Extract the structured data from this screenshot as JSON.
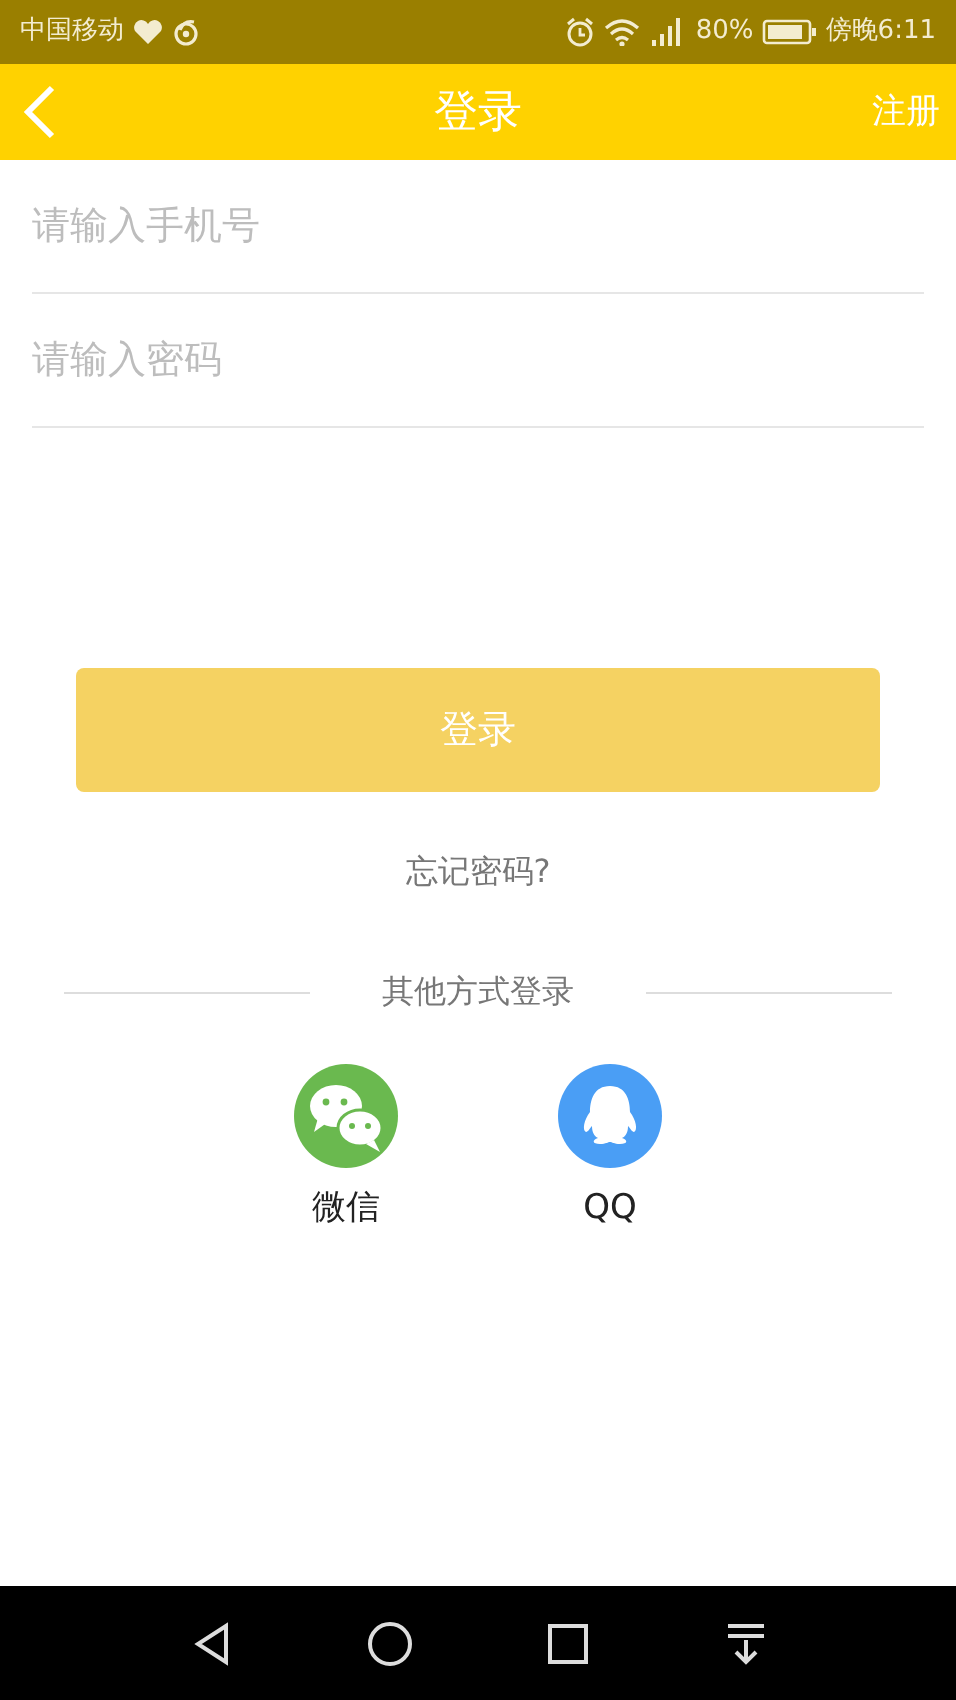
{
  "status_bar": {
    "carrier": "中国移动",
    "battery": "80%",
    "time": "傍晚6:11"
  },
  "header": {
    "title": "登录",
    "action": "注册"
  },
  "fields": [
    {
      "placeholder": "请输入手机号"
    },
    {
      "placeholder": "请输入密码"
    }
  ],
  "login_button": {
    "label": "登录",
    "disabled": true
  },
  "forgot_link": "忘记密码?",
  "other_login": {
    "heading": "其他方式登录",
    "options": [
      {
        "label": "微信",
        "kind": "wechat",
        "color": "#6ab94f"
      },
      {
        "label": "QQ",
        "kind": "qq",
        "color": "#4a9ef5"
      }
    ]
  }
}
